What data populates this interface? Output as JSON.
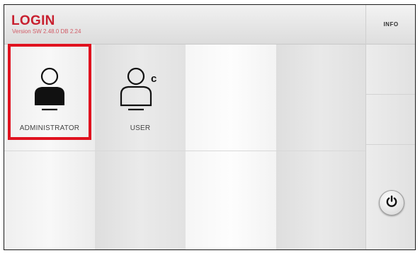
{
  "header": {
    "title": "LOGIN",
    "version": "Version SW 2.48.0 DB 2.24"
  },
  "right_panel": {
    "info_label": "INFO",
    "power_icon": "power-icon"
  },
  "tiles": [
    {
      "label": "ADMINISTRATOR",
      "icon": "user-filled-icon",
      "selected": true
    },
    {
      "label": "USER",
      "icon": "user-outline-icon",
      "badge": "C",
      "selected": false
    }
  ],
  "colors": {
    "title": "#c8202f",
    "selection": "#e0121f"
  }
}
